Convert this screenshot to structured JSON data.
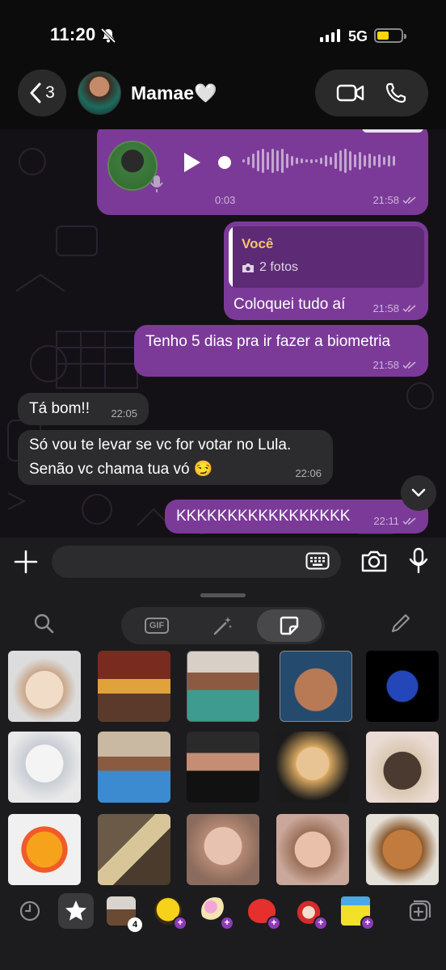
{
  "status_bar": {
    "time": "11:20",
    "network": "5G",
    "battery_level": 0.5,
    "signal_bars": 4
  },
  "header": {
    "back_count": "3",
    "contact_name": "Mamae🤍"
  },
  "messages": [
    {
      "type": "voice",
      "direction": "out",
      "duration": "0:03",
      "time": "21:58"
    },
    {
      "type": "reply",
      "direction": "out",
      "reply_author": "Você",
      "reply_preview": "2 fotos",
      "text": "Coloquei tudo aí",
      "time": "21:58"
    },
    {
      "type": "text",
      "direction": "out",
      "text": "Tenho 5 dias pra ir fazer a biometria",
      "time": "21:58"
    },
    {
      "type": "text",
      "direction": "in",
      "text": "Tá bom!!",
      "time": "22:05"
    },
    {
      "type": "text",
      "direction": "in",
      "line1": "Só vou te levar se vc for votar no Lula.",
      "line2": "Senão vc chama tua vó 😏",
      "time": "22:06"
    },
    {
      "type": "text",
      "direction": "out",
      "text": "KKKKKKKKKKKKKKKKK",
      "time": "22:11"
    }
  ],
  "sticker_panel": {
    "tabs": [
      "gif",
      "ai-sticker",
      "stickers"
    ],
    "active_tab": "stickers",
    "tray_badges": {
      "recent_pack_count": "4"
    }
  },
  "colors": {
    "outgoing_bubble": "#7b3a98",
    "incoming_bubble": "#2c2c2e",
    "reply_accent": "#f5c36a",
    "battery": "#ffd60a"
  }
}
